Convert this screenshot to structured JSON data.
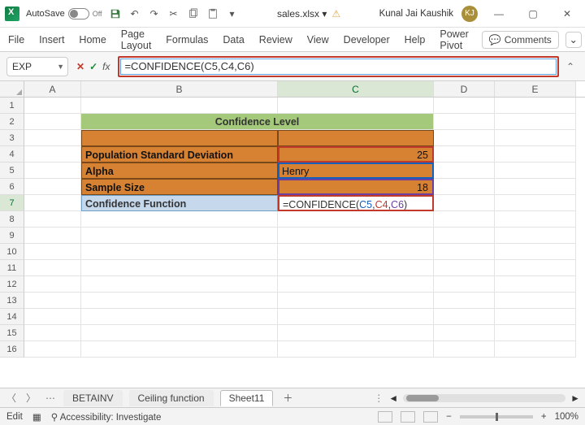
{
  "titlebar": {
    "autosave_label": "AutoSave",
    "autosave_state": "Off",
    "filename": "sales.xlsx ▾",
    "user_name": "Kunal Jai Kaushik",
    "user_initials": "KJ"
  },
  "ribbon": {
    "tabs": [
      "File",
      "Insert",
      "Home",
      "Page Layout",
      "Formulas",
      "Data",
      "Review",
      "View",
      "Developer",
      "Help",
      "Power Pivot"
    ],
    "comments_label": "Comments"
  },
  "formula_bar": {
    "name_box": "EXP",
    "formula_plain": "=CONFIDENCE(C5,C4,C6)"
  },
  "columns": [
    "A",
    "B",
    "C",
    "D",
    "E"
  ],
  "rows": [
    "1",
    "2",
    "3",
    "4",
    "5",
    "6",
    "7",
    "8",
    "9",
    "10",
    "11",
    "12",
    "13",
    "14",
    "15",
    "16"
  ],
  "data": {
    "b2": "Confidence Level",
    "b4": "Population Standard Deviation",
    "c4": "25",
    "b5": "Alpha",
    "c5": "Henry",
    "b6": "Sample Size",
    "c6": "18",
    "b7": "Confidence Function",
    "c7_prefix": "=CONFIDENCE(",
    "c7_r1": "C5",
    "c7_r2": "C4",
    "c7_r3": "C6",
    "c7_suffix": ")"
  },
  "sheet_tabs": {
    "items": [
      "BETAINV",
      "Ceiling function",
      "Sheet11"
    ],
    "active": "Sheet11"
  },
  "status": {
    "mode": "Edit",
    "accessibility": "Accessibility: Investigate",
    "zoom": "100%"
  }
}
